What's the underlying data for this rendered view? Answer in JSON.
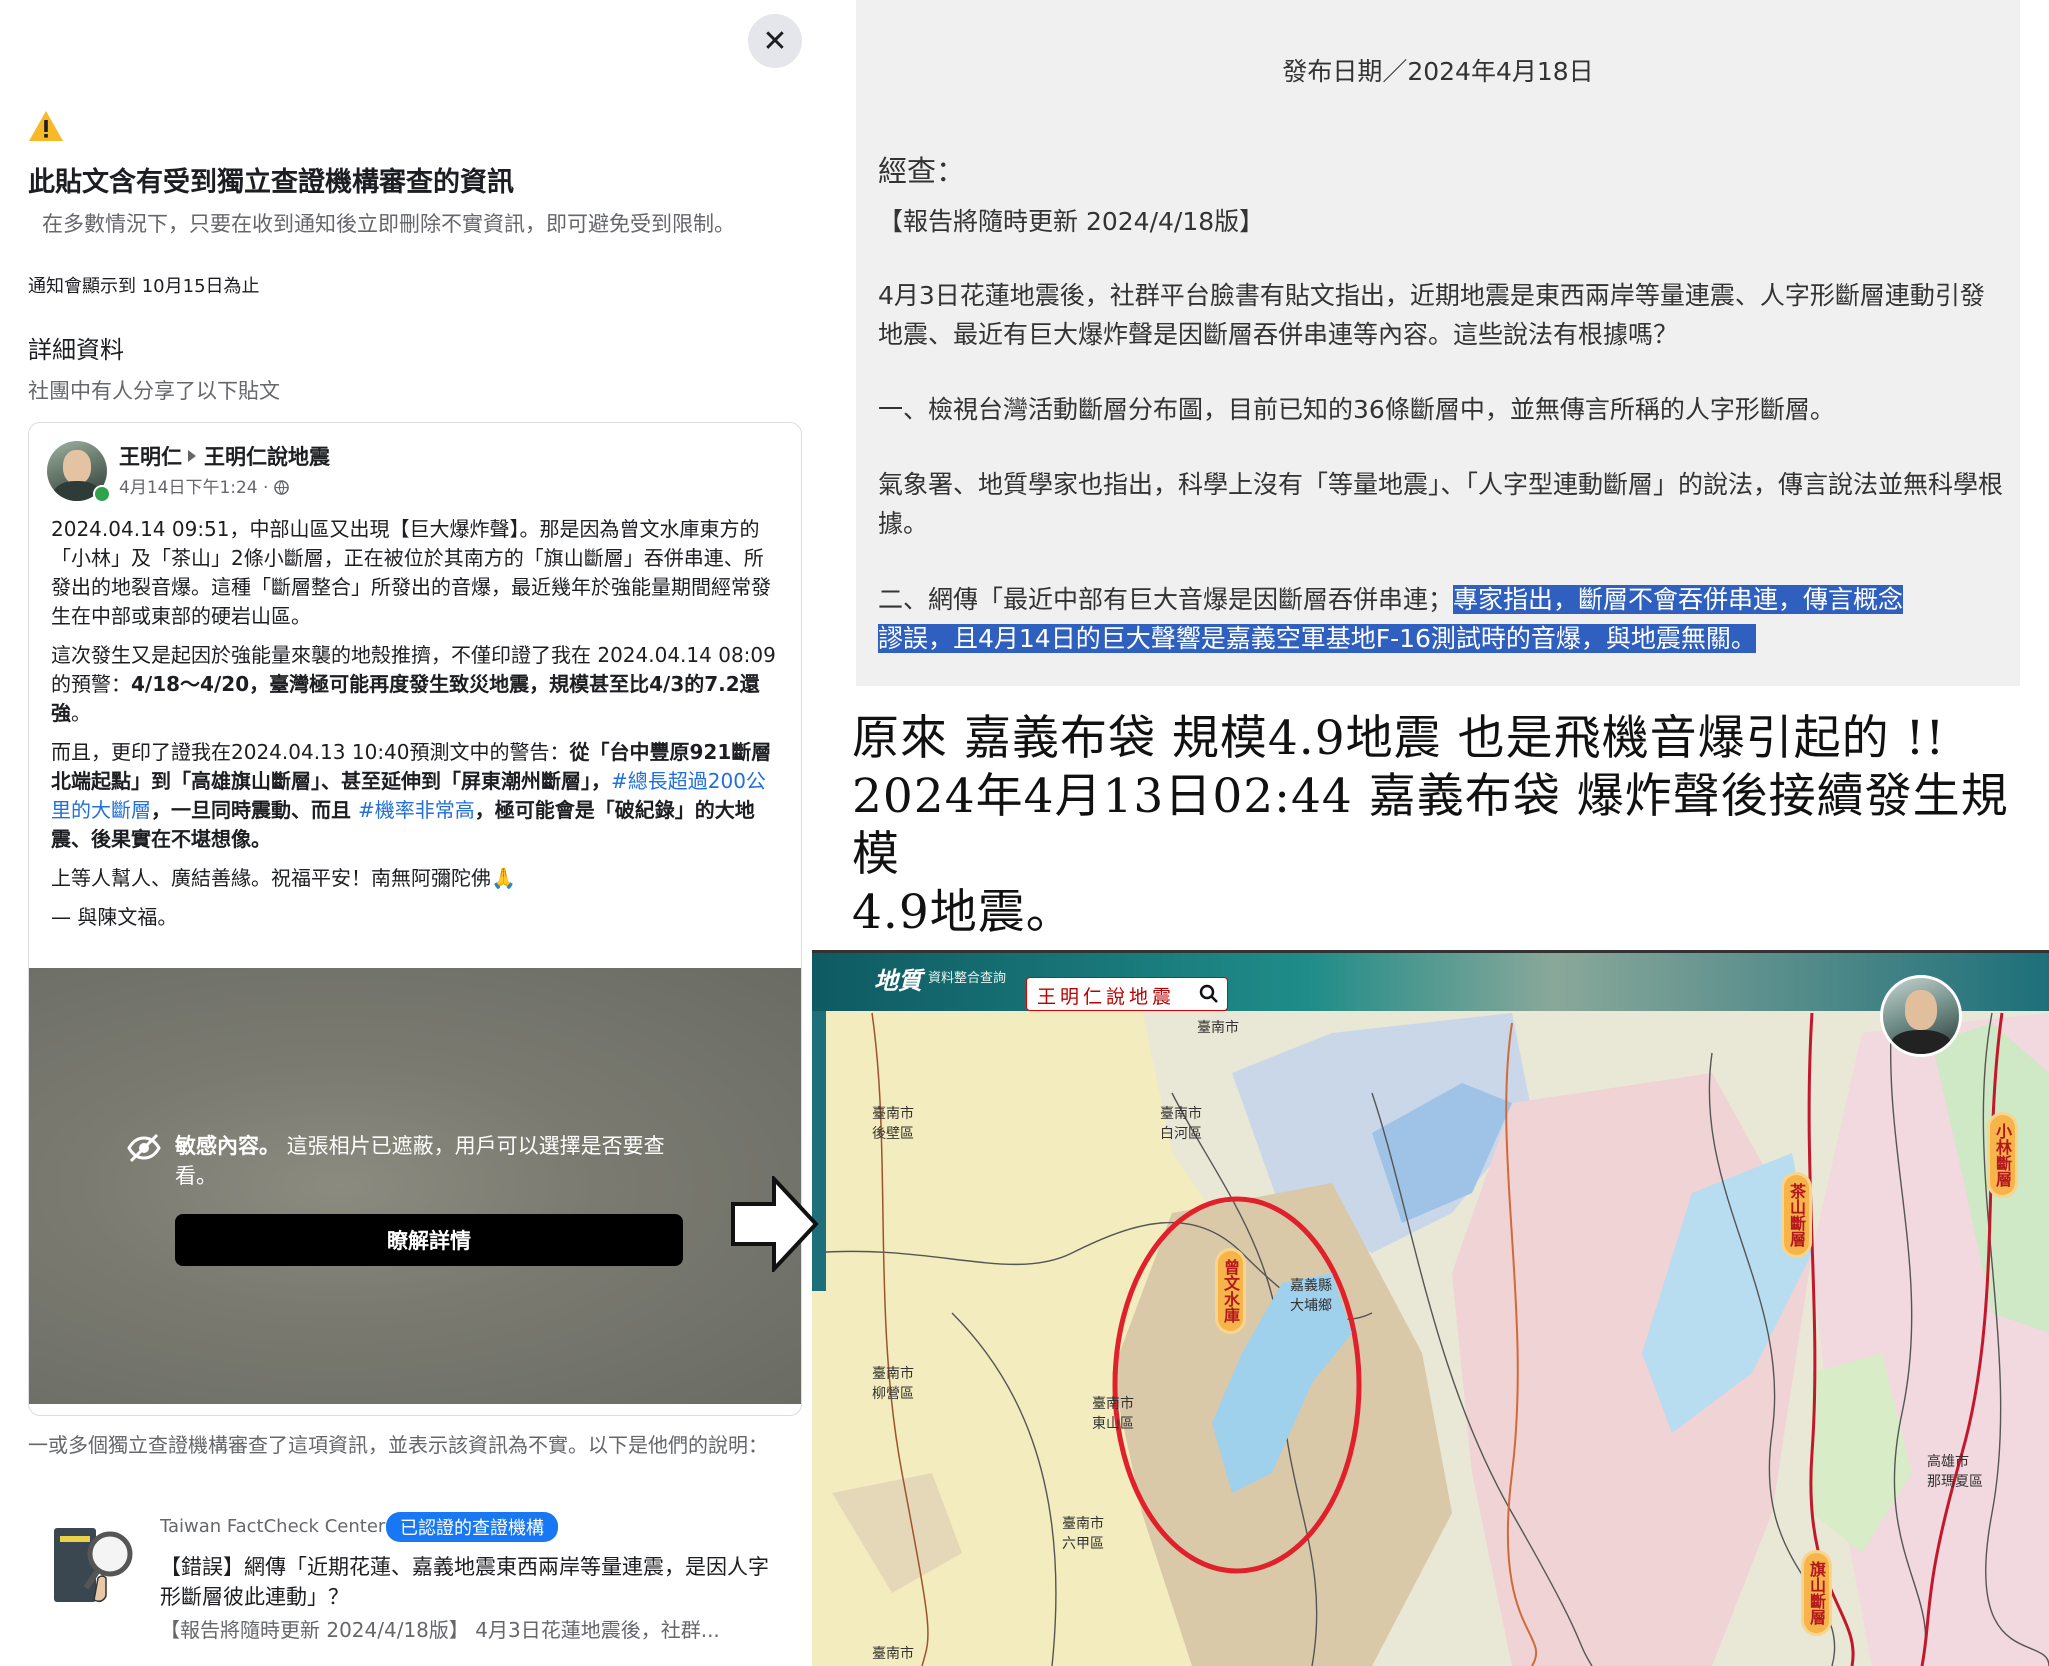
{
  "left_panel": {
    "close_label": "✕",
    "title": "此貼文含有受到獨立查證機構審查的資訊",
    "subtitle": "在多數情況下，只要在收到通知後立即刪除不實資訊，即可避免受到限制。",
    "notice": "通知會顯示到 10月15日為止",
    "details_heading": "詳細資料",
    "details_sub": "社團中有人分享了以下貼文",
    "post": {
      "author": "王明仁",
      "group": "王明仁說地震",
      "meta": "4月14日下午1:24 · ",
      "p1": "2024.04.14 09:51，中部山區又出現【巨大爆炸聲】。那是因為曾文水庫東方的「小林」及「茶山」2條小斷層，正在被位於其南方的「旗山斷層」吞併串連、所發出的地裂音爆。這種「斷層整合」所發出的音爆，最近幾年於強能量期間經常發生在中部或東部的硬岩山區。",
      "p2a": "這次發生又是起因於強能量來襲的地殼推擠，不僅印證了我在 2024.04.14 08:09的預警：",
      "p2b": "4/18～4/20，臺灣極可能再度發生致災地震，規模甚至比4/3的7.2還強",
      "p2c": "。",
      "p3a": "而且，更印了證我在2024.04.13 10:40預測文中的警告：",
      "p3b": "從「台中豐原921斷層北端起點」到「高雄旗山斷層」、甚至延伸到「屏東潮州斷層」，",
      "p3tag1": "#總長超過200公里的大斷層",
      "p3c": "，一旦同時震動、而且 ",
      "p3tag2": "#機率非常高",
      "p3d": "，極可能會是「破紀錄」的大地震、後果實在不堪想像。",
      "p4": "上等人幫人、廣結善緣。祝福平安！南無阿彌陀佛🙏",
      "p5": "— 與陳文福。"
    },
    "sensitive": {
      "title_bold": "敏感內容。",
      "title_rest": " 這張相片已遮蔽，用戶可以選擇是否要查看。",
      "button": "瞭解詳情"
    },
    "footer": "一或多個獨立查證機構審查了這項資訊，並表示該資訊為不實。以下是他們的說明：",
    "factcheck": {
      "org": "Taiwan FactCheck Center",
      "badge": "已認證的查證機構",
      "headline": "【錯誤】網傳「近期花蓮、嘉義地震東西兩岸等量連震，是因人字形斷層彼此連動」？",
      "snippet": "【報告將隨時更新 2024/4/18版】 4月3日花蓮地震後，社群..."
    }
  },
  "report": {
    "date": "發布日期／2024年4月18日",
    "jingcha": "經查：",
    "version": "【報告將隨時更新 2024/4/18版】",
    "para1": "4月3日花蓮地震後，社群平台臉書有貼文指出，近期地震是東西兩岸等量連震、人字形斷層連動引發地震、最近有巨大爆炸聲是因斷層吞併串連等內容。這些說法有根據嗎？",
    "para2": "一、檢視台灣活動斷層分布圖，目前已知的36條斷層中，並無傳言所稱的人字形斷層。",
    "para3": "氣象署、地質學家也指出，科學上沒有「等量地震」、「人字型連動斷層」的說法，傳言說法並無科學根據。",
    "para4_plain": "二、網傳「最近中部有巨大音爆是因斷層吞併串連；",
    "para4_hl1": "專家指出，斷層不會吞併串連，傳言概念",
    "para4_hl2": "謬誤，且4月14日的巨大聲響是嘉義空軍基地F-16測試時的音爆，與地震無關。"
  },
  "caption": {
    "line1": "原來  嘉義布袋  規模4.9地震  也是飛機音爆引起的  !!",
    "line2": "2024年4月13日02:44  嘉義布袋  爆炸聲後接續發生規模",
    "line3": "4.9地震。"
  },
  "map": {
    "logo": "地質",
    "subtitle": "資料整合查詢",
    "search_text": "王明仁說地震",
    "labels": {
      "tainan_houbi": "臺南市\n後壁區",
      "tainan_baihe": "臺南市\n白河區",
      "tainan_liuying": "臺南市\n柳營區",
      "tainan_dongshan": "臺南市\n東山區",
      "tainan_liujia": "臺南市\n六甲區",
      "kaohsiung_namaxia": "高雄市\n那瑪夏區",
      "chiayi_dam": "嘉義縣\n大埔鄉",
      "tainan_top": "臺南市",
      "tainan_bottom": "臺南市"
    },
    "pills": {
      "zengwen": "曾文水庫",
      "xiaolin": "小林斷層",
      "chashan": "茶山斷層",
      "qishan": "旗山斷層"
    }
  },
  "colors": {
    "fb_blue": "#1877f2",
    "highlight": "#2f5fbf",
    "warning": "#f7b928",
    "circle_red": "#e0202a"
  }
}
